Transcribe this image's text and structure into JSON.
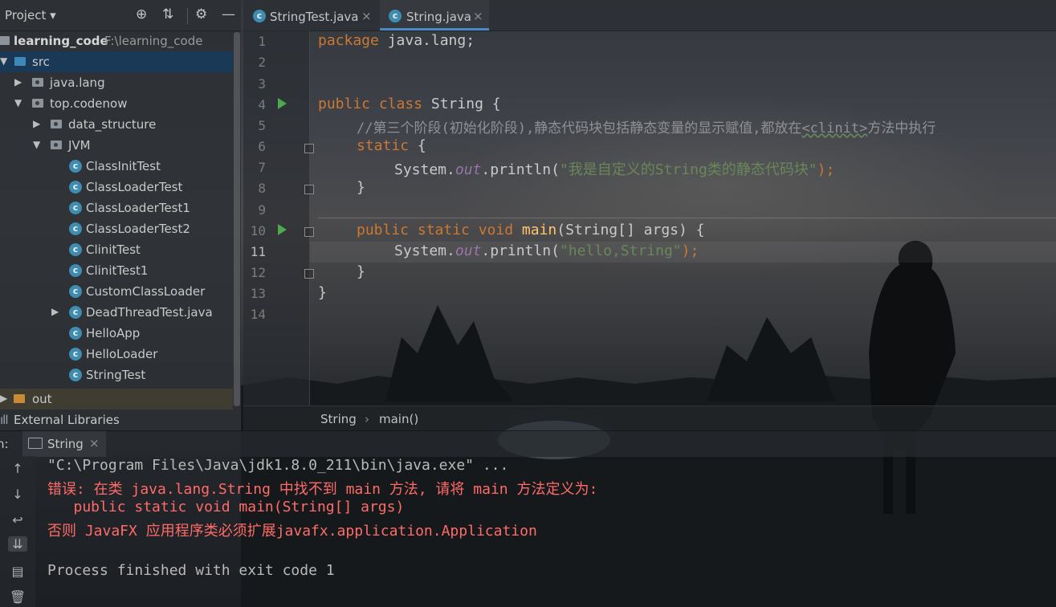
{
  "project_panel": {
    "title": "Project",
    "tree": [
      {
        "label": "learning_code",
        "sub": "F:\\learning_code",
        "level": 0,
        "type": "module",
        "expanded": true
      },
      {
        "label": "src",
        "level": 1,
        "type": "folder",
        "expanded": true,
        "selected": true
      },
      {
        "label": "java.lang",
        "level": 2,
        "type": "package",
        "expanded": false
      },
      {
        "label": "top.codenow",
        "level": 2,
        "type": "package",
        "expanded": true
      },
      {
        "label": "data_structure",
        "level": 3,
        "type": "package",
        "expanded": false
      },
      {
        "label": "JVM",
        "level": 3,
        "type": "package",
        "expanded": true
      },
      {
        "label": "ClassInitTest",
        "level": 4,
        "type": "class"
      },
      {
        "label": "ClassLoaderTest",
        "level": 4,
        "type": "class"
      },
      {
        "label": "ClassLoaderTest1",
        "level": 4,
        "type": "class"
      },
      {
        "label": "ClassLoaderTest2",
        "level": 4,
        "type": "class"
      },
      {
        "label": "ClinitTest",
        "level": 4,
        "type": "class"
      },
      {
        "label": "ClinitTest1",
        "level": 4,
        "type": "class"
      },
      {
        "label": "CustomClassLoader",
        "level": 4,
        "type": "class"
      },
      {
        "label": "DeadThreadTest.java",
        "level": 4,
        "type": "class",
        "expandable": true
      },
      {
        "label": "HelloApp",
        "level": 4,
        "type": "class"
      },
      {
        "label": "HelloLoader",
        "level": 4,
        "type": "class"
      },
      {
        "label": "StringTest",
        "level": 4,
        "type": "class"
      },
      {
        "label": "out",
        "level": 0,
        "type": "out-folder",
        "expanded": false
      },
      {
        "label": "External Libraries",
        "level": 0,
        "type": "libraries"
      }
    ]
  },
  "editor": {
    "tabs": [
      {
        "label": "StringTest.java",
        "active": false
      },
      {
        "label": "String.java",
        "active": true
      }
    ],
    "line_numbers": [
      "1",
      "2",
      "3",
      "4",
      "5",
      "6",
      "7",
      "8",
      "9",
      "10",
      "11",
      "12",
      "13",
      "14"
    ],
    "current_line": "11",
    "code": {
      "l1_kw": "package",
      "l1_rest": " java.lang;",
      "l4_kw": "public class",
      "l4_rest": " String {",
      "l5_comment": "//第三个阶段(初始化阶段),静态代码块包括静态变量的显示赋值,都放在",
      "l5_clinit": "<clinit>",
      "l5_comment2": "方法中执行",
      "l6_kw": "static",
      "l6_rest": " {",
      "l7_a": "System.",
      "l7_out": "out",
      "l7_b": ".println(",
      "l7_str": "\"我是自定义的String类的静态代码块\"",
      "l7_c": ");",
      "l8": "}",
      "l10_kw": "public static void",
      "l10_main": "main",
      "l10_rest": "(String[] args) {",
      "l11_a": "System.",
      "l11_out": "out",
      "l11_b": ".println(",
      "l11_str": "\"hello,String\"",
      "l11_c": ");",
      "l12": "}",
      "l13": "}"
    },
    "breadcrumb": {
      "class": "String",
      "separator": "›",
      "method": "main()"
    }
  },
  "run_panel": {
    "label": "n:",
    "tab": "String",
    "close": "×",
    "output": [
      {
        "text": "\"C:\\Program Files\\Java\\jdk1.8.0_211\\bin\\java.exe\" ...",
        "color": "gray"
      },
      {
        "text": "错误: 在类 java.lang.String 中找不到 main 方法, 请将 main 方法定义为:",
        "color": "red"
      },
      {
        "text": "   public static void main(String[] args)",
        "color": "red"
      },
      {
        "text": "否则 JavaFX 应用程序类必须扩展javafx.application.Application",
        "color": "red"
      },
      {
        "text": "",
        "color": "gray"
      },
      {
        "text": "Process finished with exit code 1",
        "color": "gray"
      }
    ]
  },
  "colors": {
    "keyword": "#cc7832",
    "string": "#6a8759",
    "error": "#ff6b68",
    "selection": "#193a5a",
    "run_icon": "#4ca94c"
  }
}
